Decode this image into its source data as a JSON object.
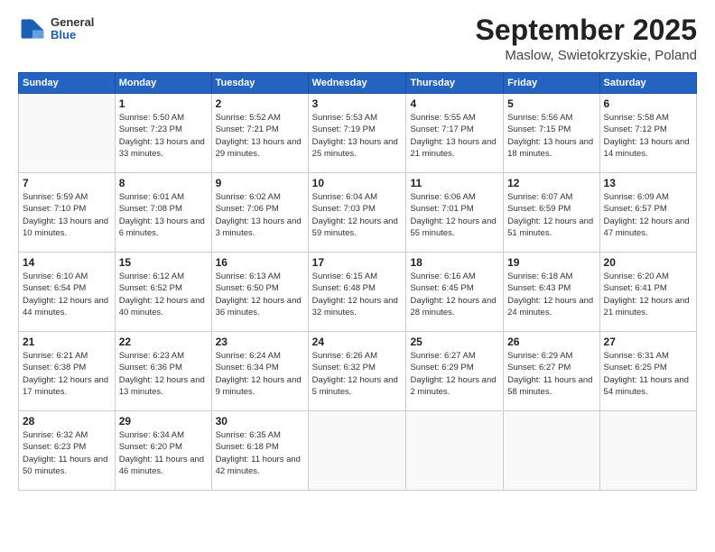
{
  "header": {
    "logo_general": "General",
    "logo_blue": "Blue",
    "title": "September 2025",
    "location": "Maslow, Swietokrzyskie, Poland"
  },
  "days_of_week": [
    "Sunday",
    "Monday",
    "Tuesday",
    "Wednesday",
    "Thursday",
    "Friday",
    "Saturday"
  ],
  "weeks": [
    [
      {
        "day": "",
        "sunrise": "",
        "sunset": "",
        "daylight": ""
      },
      {
        "day": "1",
        "sunrise": "Sunrise: 5:50 AM",
        "sunset": "Sunset: 7:23 PM",
        "daylight": "Daylight: 13 hours and 33 minutes."
      },
      {
        "day": "2",
        "sunrise": "Sunrise: 5:52 AM",
        "sunset": "Sunset: 7:21 PM",
        "daylight": "Daylight: 13 hours and 29 minutes."
      },
      {
        "day": "3",
        "sunrise": "Sunrise: 5:53 AM",
        "sunset": "Sunset: 7:19 PM",
        "daylight": "Daylight: 13 hours and 25 minutes."
      },
      {
        "day": "4",
        "sunrise": "Sunrise: 5:55 AM",
        "sunset": "Sunset: 7:17 PM",
        "daylight": "Daylight: 13 hours and 21 minutes."
      },
      {
        "day": "5",
        "sunrise": "Sunrise: 5:56 AM",
        "sunset": "Sunset: 7:15 PM",
        "daylight": "Daylight: 13 hours and 18 minutes."
      },
      {
        "day": "6",
        "sunrise": "Sunrise: 5:58 AM",
        "sunset": "Sunset: 7:12 PM",
        "daylight": "Daylight: 13 hours and 14 minutes."
      }
    ],
    [
      {
        "day": "7",
        "sunrise": "Sunrise: 5:59 AM",
        "sunset": "Sunset: 7:10 PM",
        "daylight": "Daylight: 13 hours and 10 minutes."
      },
      {
        "day": "8",
        "sunrise": "Sunrise: 6:01 AM",
        "sunset": "Sunset: 7:08 PM",
        "daylight": "Daylight: 13 hours and 6 minutes."
      },
      {
        "day": "9",
        "sunrise": "Sunrise: 6:02 AM",
        "sunset": "Sunset: 7:06 PM",
        "daylight": "Daylight: 13 hours and 3 minutes."
      },
      {
        "day": "10",
        "sunrise": "Sunrise: 6:04 AM",
        "sunset": "Sunset: 7:03 PM",
        "daylight": "Daylight: 12 hours and 59 minutes."
      },
      {
        "day": "11",
        "sunrise": "Sunrise: 6:06 AM",
        "sunset": "Sunset: 7:01 PM",
        "daylight": "Daylight: 12 hours and 55 minutes."
      },
      {
        "day": "12",
        "sunrise": "Sunrise: 6:07 AM",
        "sunset": "Sunset: 6:59 PM",
        "daylight": "Daylight: 12 hours and 51 minutes."
      },
      {
        "day": "13",
        "sunrise": "Sunrise: 6:09 AM",
        "sunset": "Sunset: 6:57 PM",
        "daylight": "Daylight: 12 hours and 47 minutes."
      }
    ],
    [
      {
        "day": "14",
        "sunrise": "Sunrise: 6:10 AM",
        "sunset": "Sunset: 6:54 PM",
        "daylight": "Daylight: 12 hours and 44 minutes."
      },
      {
        "day": "15",
        "sunrise": "Sunrise: 6:12 AM",
        "sunset": "Sunset: 6:52 PM",
        "daylight": "Daylight: 12 hours and 40 minutes."
      },
      {
        "day": "16",
        "sunrise": "Sunrise: 6:13 AM",
        "sunset": "Sunset: 6:50 PM",
        "daylight": "Daylight: 12 hours and 36 minutes."
      },
      {
        "day": "17",
        "sunrise": "Sunrise: 6:15 AM",
        "sunset": "Sunset: 6:48 PM",
        "daylight": "Daylight: 12 hours and 32 minutes."
      },
      {
        "day": "18",
        "sunrise": "Sunrise: 6:16 AM",
        "sunset": "Sunset: 6:45 PM",
        "daylight": "Daylight: 12 hours and 28 minutes."
      },
      {
        "day": "19",
        "sunrise": "Sunrise: 6:18 AM",
        "sunset": "Sunset: 6:43 PM",
        "daylight": "Daylight: 12 hours and 24 minutes."
      },
      {
        "day": "20",
        "sunrise": "Sunrise: 6:20 AM",
        "sunset": "Sunset: 6:41 PM",
        "daylight": "Daylight: 12 hours and 21 minutes."
      }
    ],
    [
      {
        "day": "21",
        "sunrise": "Sunrise: 6:21 AM",
        "sunset": "Sunset: 6:38 PM",
        "daylight": "Daylight: 12 hours and 17 minutes."
      },
      {
        "day": "22",
        "sunrise": "Sunrise: 6:23 AM",
        "sunset": "Sunset: 6:36 PM",
        "daylight": "Daylight: 12 hours and 13 minutes."
      },
      {
        "day": "23",
        "sunrise": "Sunrise: 6:24 AM",
        "sunset": "Sunset: 6:34 PM",
        "daylight": "Daylight: 12 hours and 9 minutes."
      },
      {
        "day": "24",
        "sunrise": "Sunrise: 6:26 AM",
        "sunset": "Sunset: 6:32 PM",
        "daylight": "Daylight: 12 hours and 5 minutes."
      },
      {
        "day": "25",
        "sunrise": "Sunrise: 6:27 AM",
        "sunset": "Sunset: 6:29 PM",
        "daylight": "Daylight: 12 hours and 2 minutes."
      },
      {
        "day": "26",
        "sunrise": "Sunrise: 6:29 AM",
        "sunset": "Sunset: 6:27 PM",
        "daylight": "Daylight: 11 hours and 58 minutes."
      },
      {
        "day": "27",
        "sunrise": "Sunrise: 6:31 AM",
        "sunset": "Sunset: 6:25 PM",
        "daylight": "Daylight: 11 hours and 54 minutes."
      }
    ],
    [
      {
        "day": "28",
        "sunrise": "Sunrise: 6:32 AM",
        "sunset": "Sunset: 6:23 PM",
        "daylight": "Daylight: 11 hours and 50 minutes."
      },
      {
        "day": "29",
        "sunrise": "Sunrise: 6:34 AM",
        "sunset": "Sunset: 6:20 PM",
        "daylight": "Daylight: 11 hours and 46 minutes."
      },
      {
        "day": "30",
        "sunrise": "Sunrise: 6:35 AM",
        "sunset": "Sunset: 6:18 PM",
        "daylight": "Daylight: 11 hours and 42 minutes."
      },
      {
        "day": "",
        "sunrise": "",
        "sunset": "",
        "daylight": ""
      },
      {
        "day": "",
        "sunrise": "",
        "sunset": "",
        "daylight": ""
      },
      {
        "day": "",
        "sunrise": "",
        "sunset": "",
        "daylight": ""
      },
      {
        "day": "",
        "sunrise": "",
        "sunset": "",
        "daylight": ""
      }
    ]
  ]
}
